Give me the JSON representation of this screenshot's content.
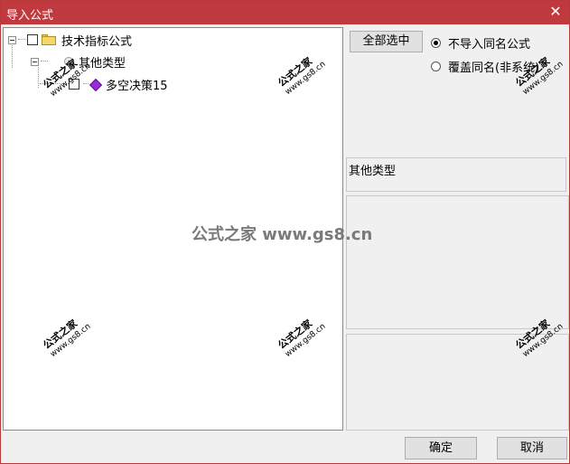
{
  "window": {
    "title": "导入公式",
    "close_glyph": "✕",
    "accent_color": "#c0393e"
  },
  "tree": {
    "root": {
      "label": "技术指标公式",
      "icon": "folder-icon"
    },
    "group": {
      "label": "其他类型",
      "icon": "bubble-icon"
    },
    "item": {
      "label": "多空决策15",
      "icon": "gem-icon"
    }
  },
  "options": {
    "select_all_label": "全部选中",
    "radio_skip_label": "不导入同名公式",
    "radio_overwrite_label": "覆盖同名(非系统)",
    "selected": "skip"
  },
  "details": {
    "name_value": "其他类型"
  },
  "footer": {
    "ok_label": "确定",
    "cancel_label": "取消"
  },
  "watermark": {
    "center_text": "公式之家 www.gs8.cn",
    "stamp_text": "公式之家",
    "stamp_url": "www.gs8.cn"
  }
}
